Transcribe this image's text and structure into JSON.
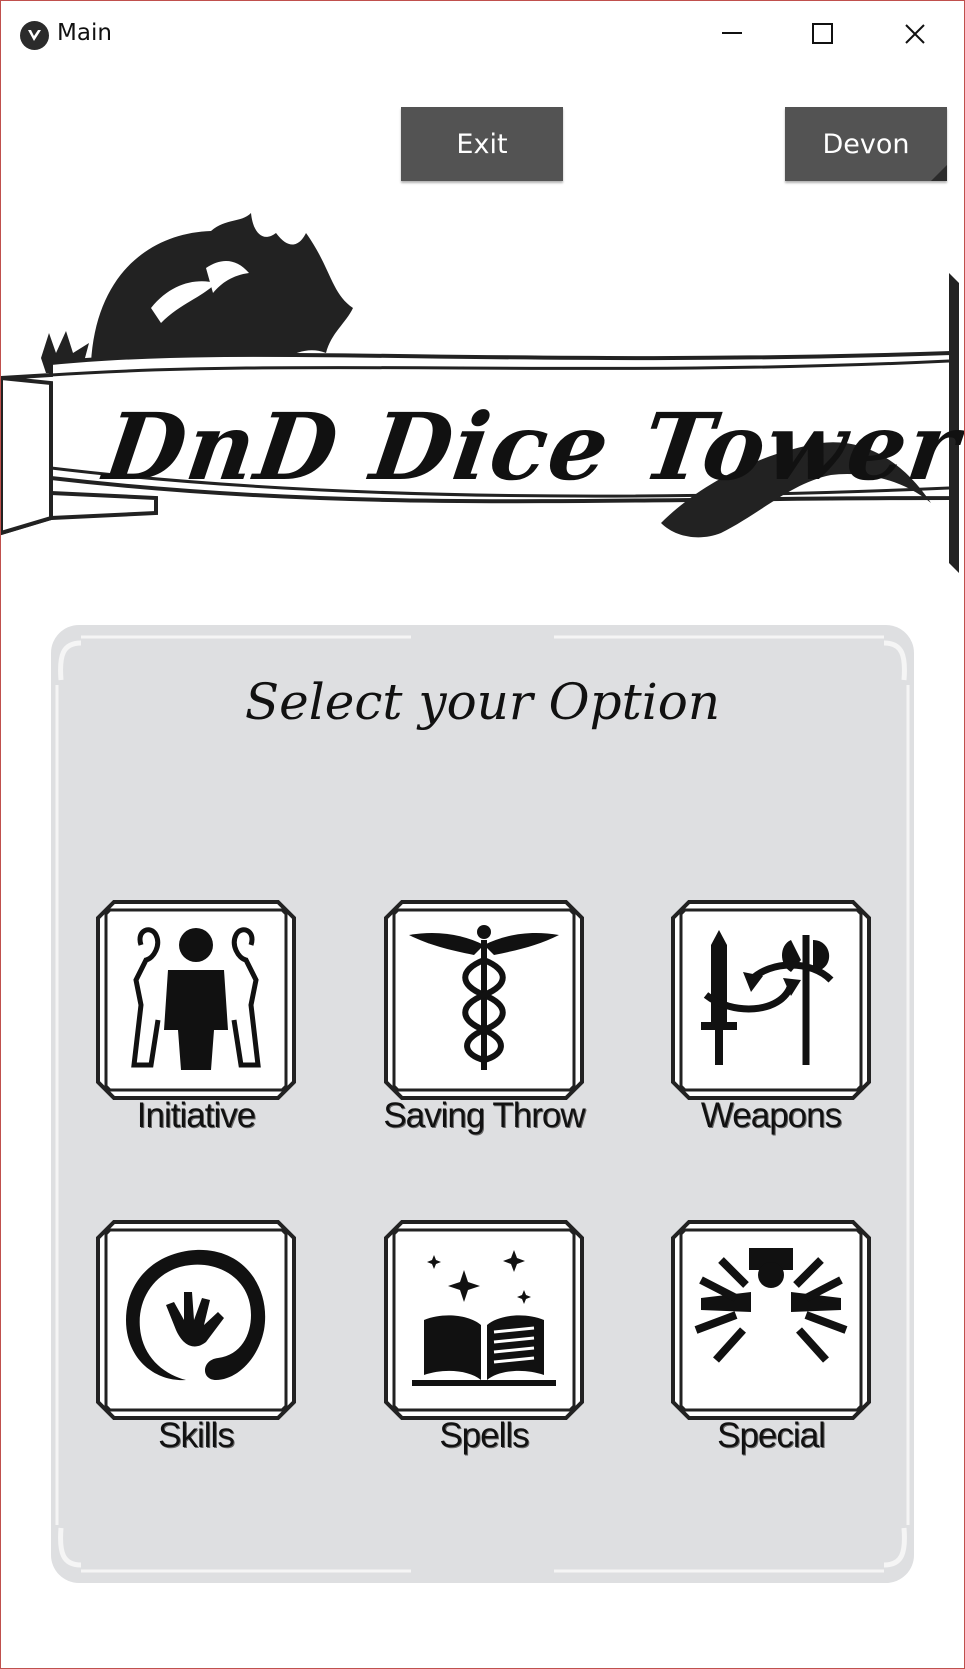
{
  "window": {
    "title": "Main",
    "border_color": "#c0504d"
  },
  "titlebar_icons": [
    "app-logo-icon",
    "minimize-icon",
    "maximize-icon",
    "close-icon"
  ],
  "header_buttons": {
    "exit_label": "Exit",
    "user_label": "Devon",
    "button_color": "#535353"
  },
  "banner": {
    "title": "DnD Dice Tower",
    "icon": "dragon-icon"
  },
  "panel": {
    "heading": "Select your Option",
    "background": "#dedfe1"
  },
  "options": [
    {
      "label": "Initiative",
      "icon": "party-icon"
    },
    {
      "label": "Saving Throw",
      "icon": "caduceus-icon"
    },
    {
      "label": "Weapons",
      "icon": "weapon-swap-icon"
    },
    {
      "label": "Skills",
      "icon": "hand-swirl-icon"
    },
    {
      "label": "Spells",
      "icon": "spellbook-icon"
    },
    {
      "label": "Special",
      "icon": "radiant-figure-icon"
    }
  ]
}
